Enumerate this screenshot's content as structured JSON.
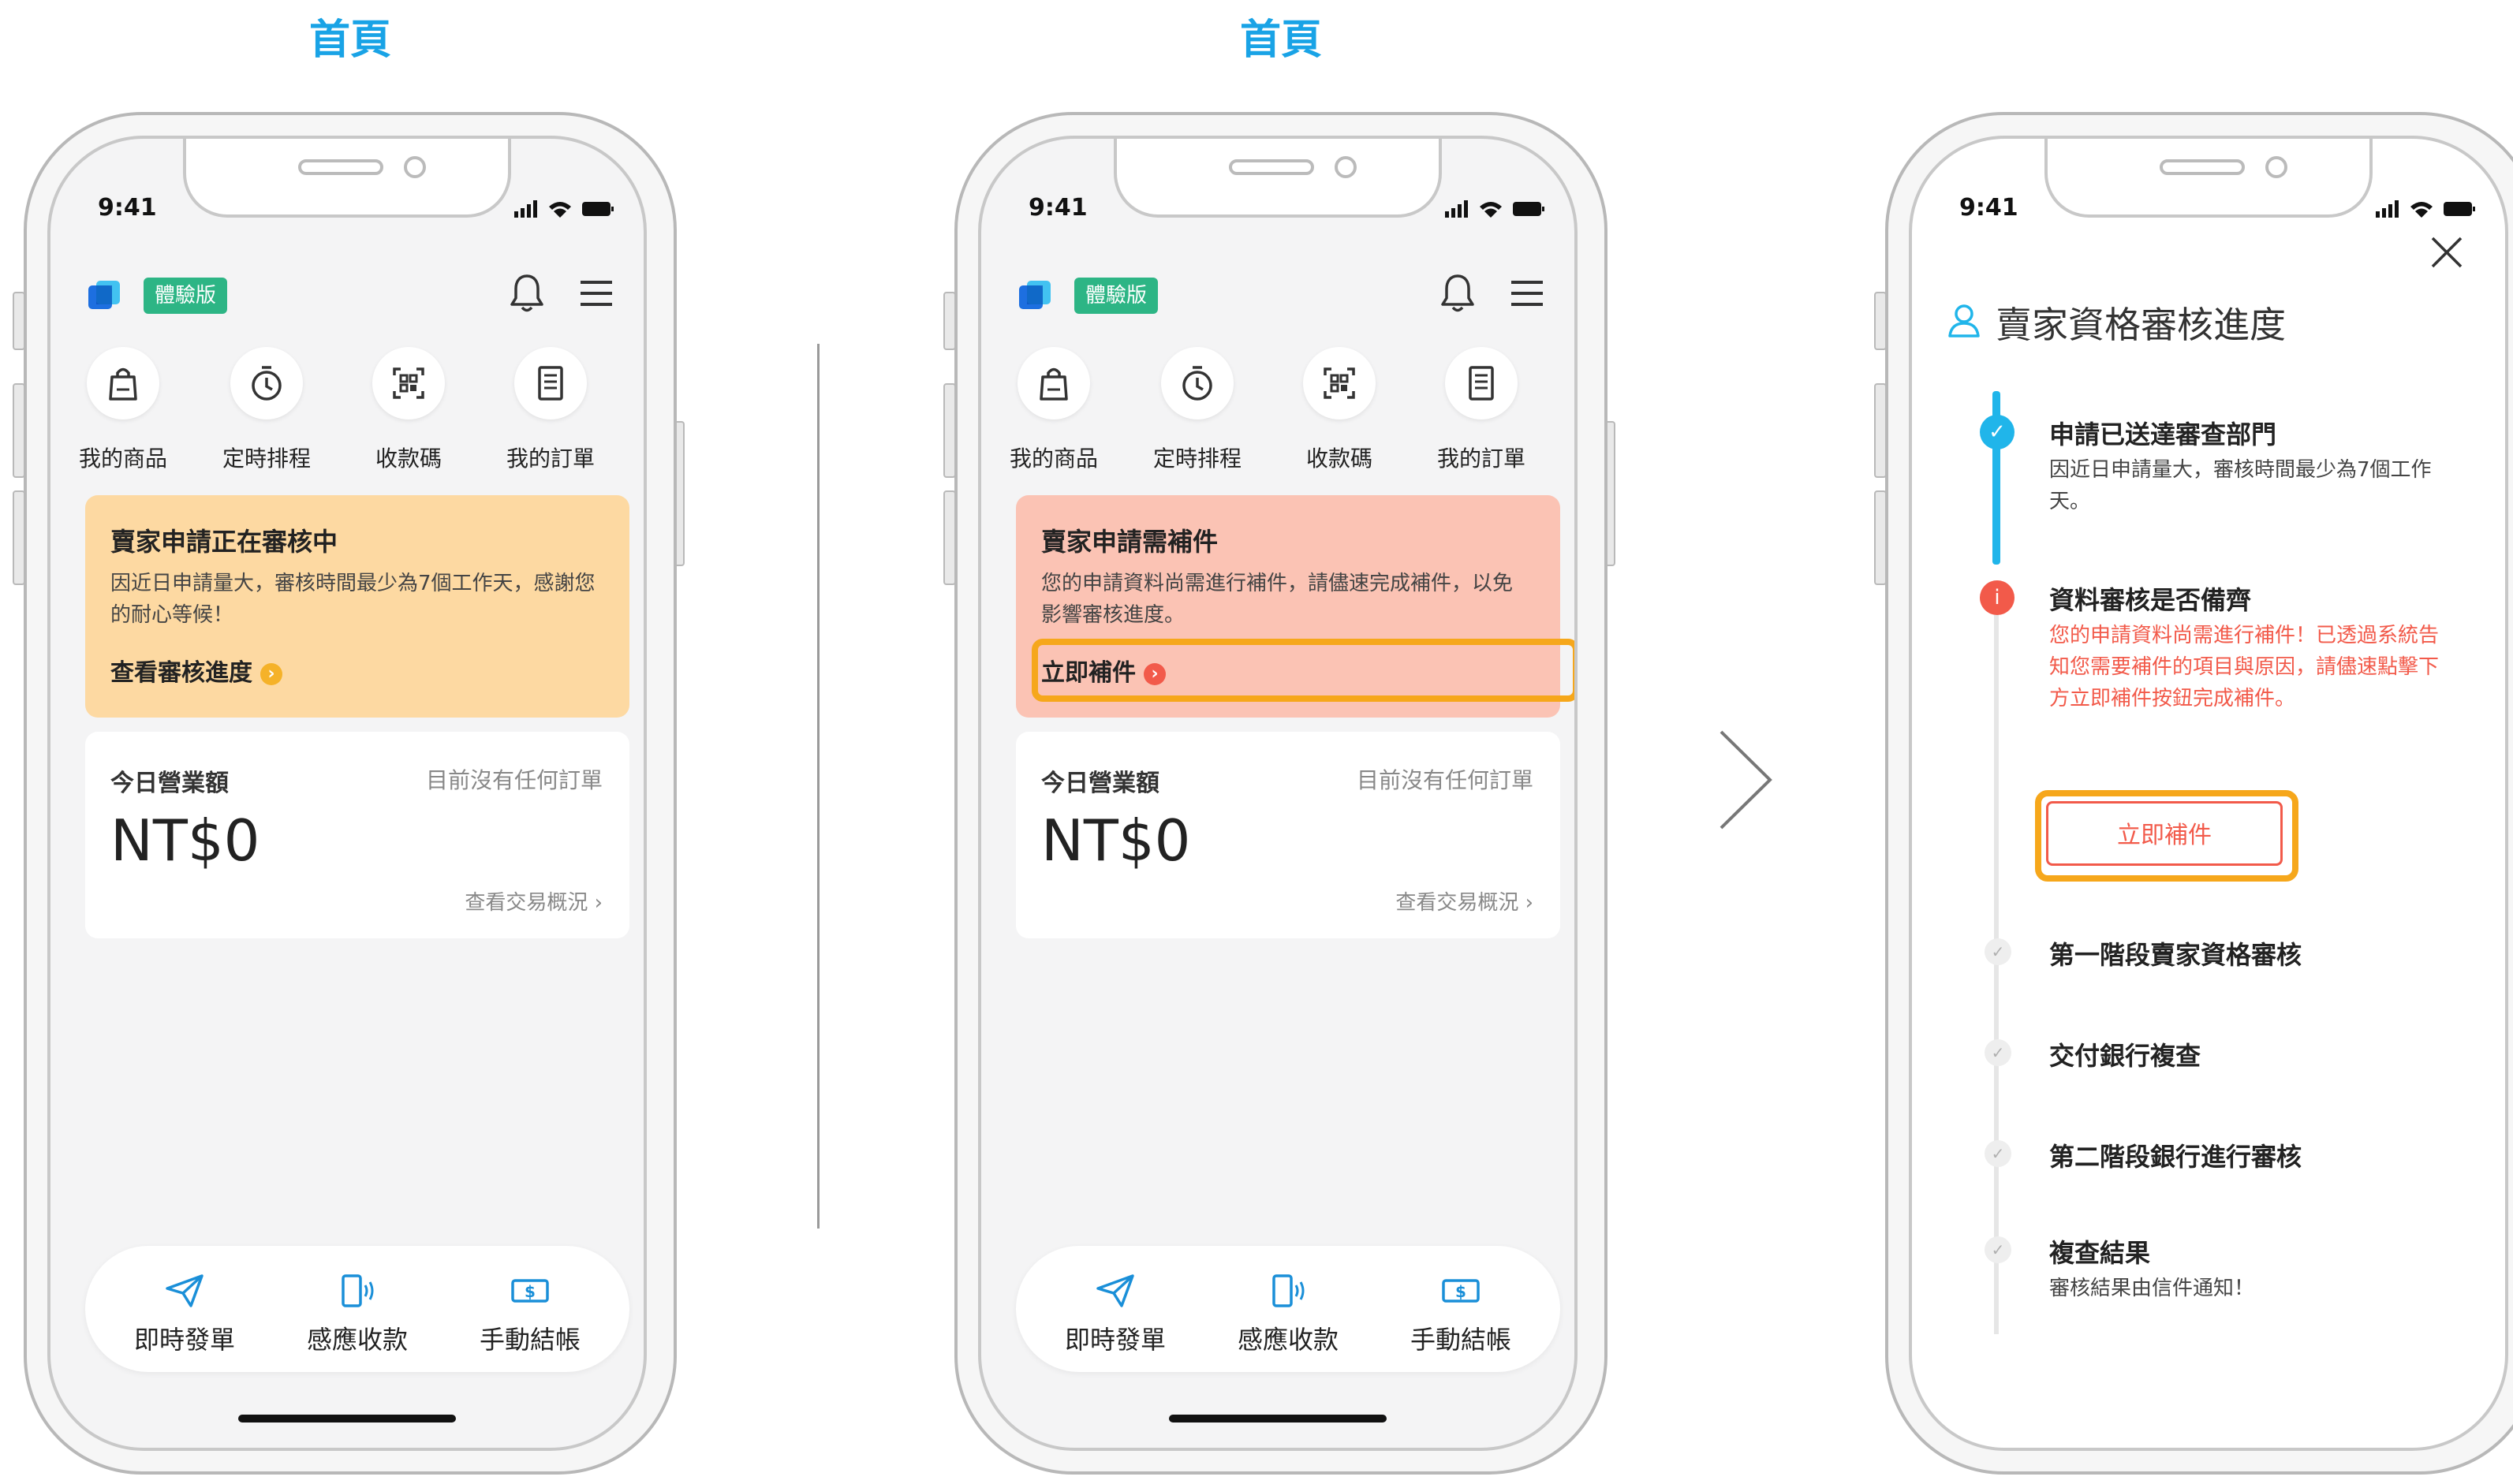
{
  "screens": [
    {
      "title": "首頁",
      "status_time": "9:41",
      "trial_badge": "體驗版",
      "quick_actions": [
        {
          "label": "我的商品",
          "icon": "bag-icon"
        },
        {
          "label": "定時排程",
          "icon": "timer-icon"
        },
        {
          "label": "收款碼",
          "icon": "qr-scan-icon"
        },
        {
          "label": "我的訂單",
          "icon": "receipt-icon"
        }
      ],
      "notice": {
        "title": "賣家申請正在審核中",
        "body": "因近日申請量大，審核時間最少為7個工作天，感謝您的耐心等候！",
        "link_text": "查看審核進度",
        "link_icon": "chevron-right-icon",
        "color": "#fdd9a2"
      },
      "sales": {
        "label": "今日營業額",
        "status": "目前沒有任何訂單",
        "amount": "NT$0",
        "link": "查看交易概況 ›"
      },
      "bottom_nav": [
        {
          "label": "即時發單",
          "icon": "send-icon"
        },
        {
          "label": "感應收款",
          "icon": "nfc-icon"
        },
        {
          "label": "手動結帳",
          "icon": "cash-icon"
        }
      ]
    },
    {
      "title": "首頁",
      "status_time": "9:41",
      "trial_badge": "體驗版",
      "quick_actions": [
        {
          "label": "我的商品",
          "icon": "bag-icon"
        },
        {
          "label": "定時排程",
          "icon": "timer-icon"
        },
        {
          "label": "收款碼",
          "icon": "qr-scan-icon"
        },
        {
          "label": "我的訂單",
          "icon": "receipt-icon"
        }
      ],
      "notice": {
        "title": "賣家申請需補件",
        "body": "您的申請資料尚需進行補件，請儘速完成補件，以免影響審核進度。",
        "link_text": "立即補件",
        "link_icon": "chevron-right-icon",
        "color": "#fbc3b4"
      },
      "sales": {
        "label": "今日營業額",
        "status": "目前沒有任何訂單",
        "amount": "NT$0",
        "link": "查看交易概況 ›"
      },
      "bottom_nav": [
        {
          "label": "即時發單",
          "icon": "send-icon"
        },
        {
          "label": "感應收款",
          "icon": "nfc-icon"
        },
        {
          "label": "手動結帳",
          "icon": "cash-icon"
        }
      ]
    },
    {
      "status_time": "9:41",
      "panel_title": "賣家資格審核進度",
      "steps": [
        {
          "title": "申請已送達審查部門",
          "desc": "因近日申請量大，審核時間最少為7個工作天。",
          "state": "done"
        },
        {
          "title": "資料審核是否備齊",
          "desc": "您的申請資料尚需進行補件！已透過系統告知您需要補件的項目與原因，請儘速點擊下方立即補件按鈕完成補件。",
          "state": "alert"
        },
        {
          "title": "第一階段賣家資格審核",
          "desc": "",
          "state": "pending"
        },
        {
          "title": "交付銀行複查",
          "desc": "",
          "state": "pending"
        },
        {
          "title": "第二階段銀行進行審核",
          "desc": "",
          "state": "pending"
        },
        {
          "title": "複查結果",
          "desc": "審核結果由信件通知！",
          "state": "pending"
        }
      ],
      "supplement_button": "立即補件"
    }
  ],
  "colors": {
    "title_blue": "#19a3e6",
    "trial_green": "#2db585",
    "highlight_orange": "#f6a71b",
    "alert_red": "#f25a4a",
    "progress_blue": "#20b5ea"
  }
}
